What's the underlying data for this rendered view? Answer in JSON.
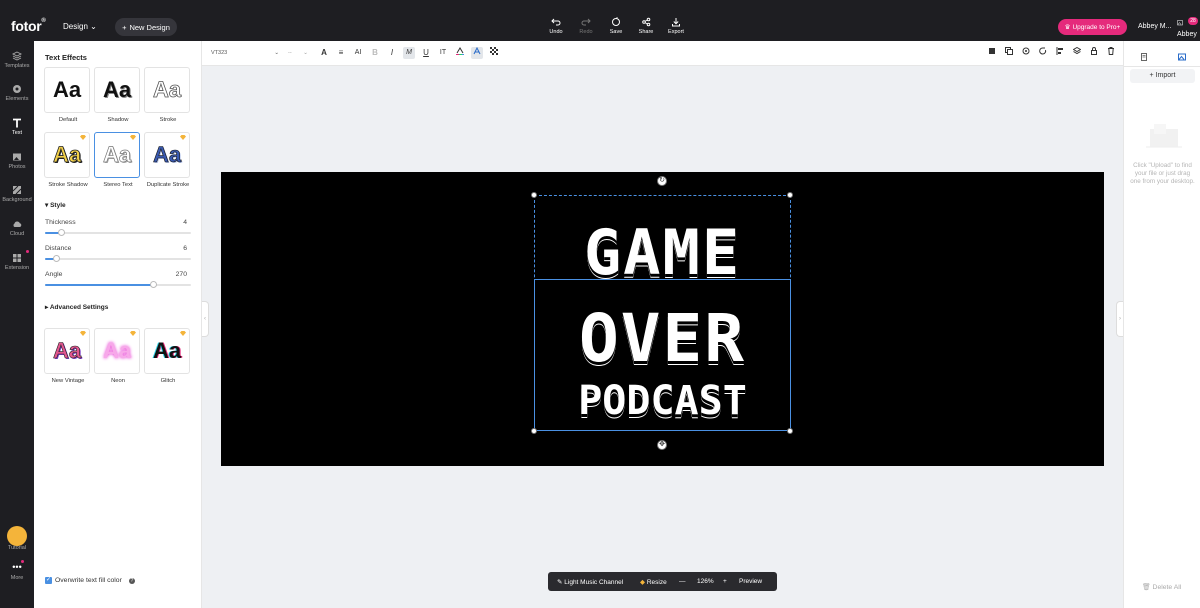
{
  "app": {
    "logo": "fotor",
    "logo_mark": "®",
    "design_menu": "Design",
    "new_design": "New Design"
  },
  "header_actions": [
    {
      "label": "Undo",
      "icon": "undo-icon"
    },
    {
      "label": "Redo",
      "icon": "redo-icon",
      "disabled": true
    },
    {
      "label": "Save",
      "icon": "save-icon"
    },
    {
      "label": "Share",
      "icon": "share-icon"
    },
    {
      "label": "Export",
      "icon": "export-icon"
    }
  ],
  "header_right": {
    "upgrade": "Upgrade to Pro+",
    "username": "Abbey M...",
    "avatar_name": "Abbey",
    "notification_count": "28"
  },
  "rail": [
    {
      "label": "Templates",
      "icon": "templates-icon"
    },
    {
      "label": "Elements",
      "icon": "elements-icon"
    },
    {
      "label": "Text",
      "icon": "text-icon",
      "active": true
    },
    {
      "label": "Photos",
      "icon": "photos-icon"
    },
    {
      "label": "Background",
      "icon": "background-icon"
    },
    {
      "label": "Cloud",
      "icon": "cloud-icon"
    },
    {
      "label": "Extension",
      "icon": "extension-icon"
    }
  ],
  "rail_bottom": {
    "tutorial": "Tutorial",
    "more": "More"
  },
  "panel": {
    "title": "Text Effects",
    "effects": [
      {
        "label": "Default",
        "sample": "Aa",
        "pro": false
      },
      {
        "label": "Shadow",
        "sample": "Aa",
        "pro": false
      },
      {
        "label": "Stroke",
        "sample": "Aa",
        "pro": false
      },
      {
        "label": "Stroke Shadow",
        "sample": "Aa",
        "pro": true
      },
      {
        "label": "Stereo Text",
        "sample": "Aa",
        "pro": true,
        "selected": true
      },
      {
        "label": "Duplicate Stroke",
        "sample": "Aa",
        "pro": true
      }
    ],
    "style_label": "Style",
    "sliders": [
      {
        "label": "Thickness",
        "value": "4",
        "fraction": 0.11
      },
      {
        "label": "Distance",
        "value": "6",
        "fraction": 0.08
      },
      {
        "label": "Angle",
        "value": "270",
        "fraction": 0.74
      }
    ],
    "advanced_label": "Advanced Settings",
    "more_effects": [
      {
        "label": "New Vintage",
        "sample": "Aa",
        "pro": true
      },
      {
        "label": "Neon",
        "sample": "Aa",
        "pro": true
      },
      {
        "label": "Glitch",
        "sample": "Aa",
        "pro": true
      }
    ],
    "overwrite_label": "Overwrite text fill color",
    "help": "?"
  },
  "toolbar": {
    "font": "VT323",
    "font_size": "--"
  },
  "canvas": {
    "line1": "GAME",
    "line2": "OVER",
    "line3": "PODCAST"
  },
  "right_panel": {
    "import": "Import",
    "hint": "Click \"Upload\" to find your file or just drag one from your desktop.",
    "delete_all": "Delete All"
  },
  "bottom_bar": {
    "page_name": "Light Music Channel",
    "resize": "Resize",
    "zoom": "126%",
    "preview": "Preview"
  },
  "colors": {
    "accent": "#4a90e2",
    "brand_pink": "#e52a7c",
    "chrome": "#1e1e22"
  }
}
